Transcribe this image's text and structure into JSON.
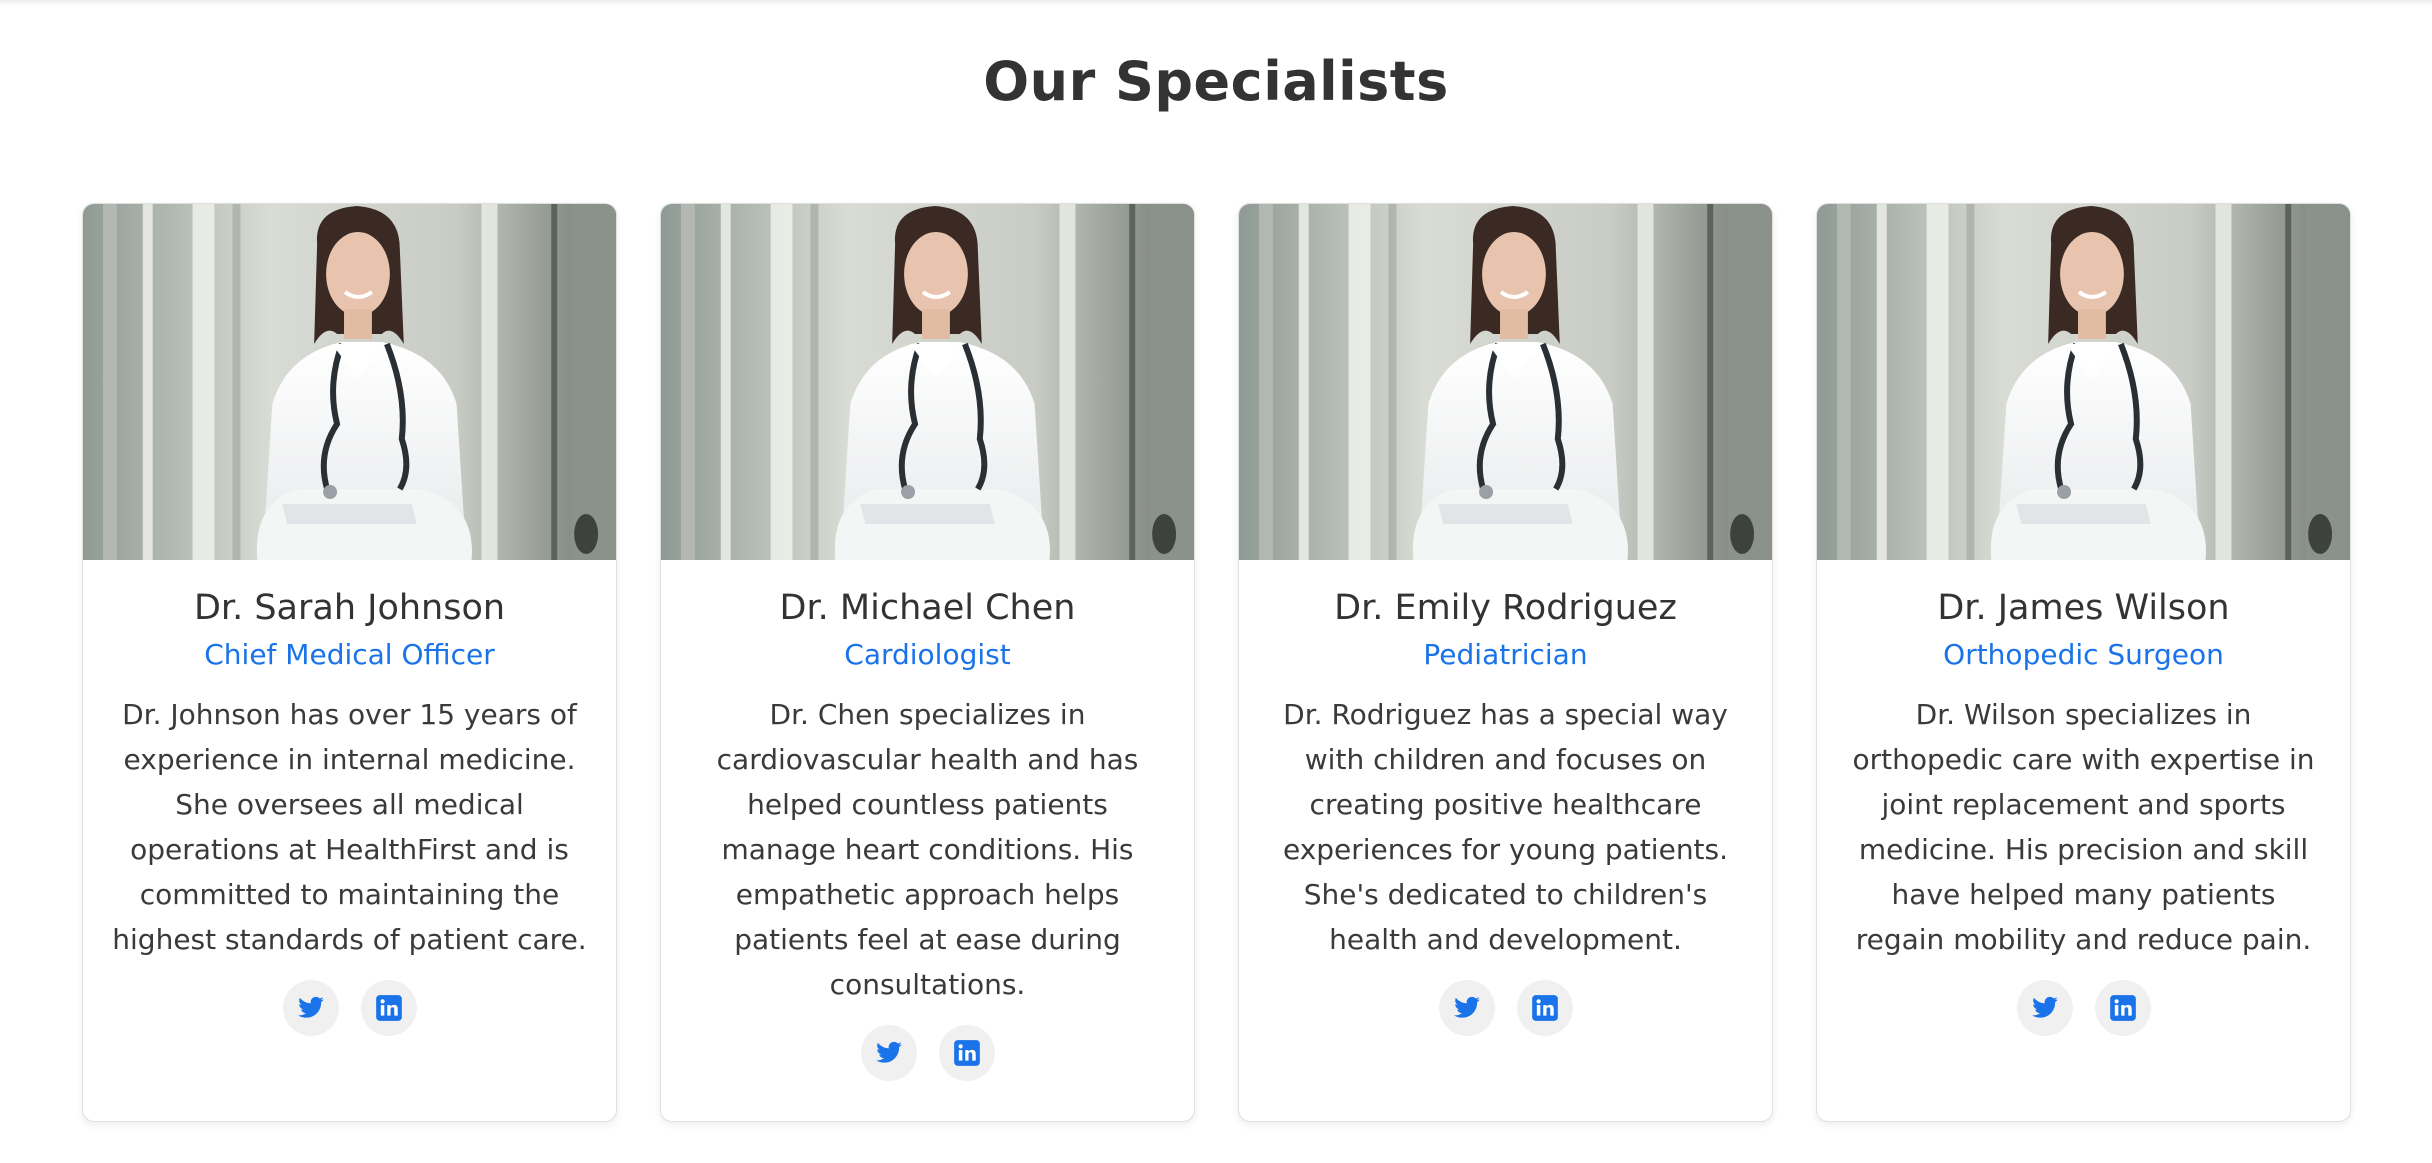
{
  "section": {
    "title": "Our Specialists"
  },
  "colors": {
    "accent": "#1a73e8",
    "text": "#333333",
    "icon_bg": "#f0f0f0"
  },
  "doctors": [
    {
      "name": "Dr. Sarah Johnson",
      "role": "Chief Medical Officer",
      "bio": "Dr. Johnson has over 15 years of experience in internal medicine. She oversees all medical operations at HealthFirst and is committed to maintaining the highest standards of patient care.",
      "photo_icon": "doctor-portrait",
      "socials": [
        "twitter-icon",
        "linkedin-icon"
      ]
    },
    {
      "name": "Dr. Michael Chen",
      "role": "Cardiologist",
      "bio": "Dr. Chen specializes in cardiovascular health and has helped countless patients manage heart conditions. His empathetic approach helps patients feel at ease during consultations.",
      "photo_icon": "doctor-portrait",
      "socials": [
        "twitter-icon",
        "linkedin-icon"
      ]
    },
    {
      "name": "Dr. Emily Rodriguez",
      "role": "Pediatrician",
      "bio": "Dr. Rodriguez has a special way with children and focuses on creating positive healthcare experiences for young patients. She's dedicated to children's health and development.",
      "photo_icon": "doctor-portrait",
      "socials": [
        "twitter-icon",
        "linkedin-icon"
      ]
    },
    {
      "name": "Dr. James Wilson",
      "role": "Orthopedic Surgeon",
      "bio": "Dr. Wilson specializes in orthopedic care with expertise in joint replacement and sports medicine. His precision and skill have helped many patients regain mobility and reduce pain.",
      "photo_icon": "doctor-portrait",
      "socials": [
        "twitter-icon",
        "linkedin-icon"
      ]
    }
  ]
}
